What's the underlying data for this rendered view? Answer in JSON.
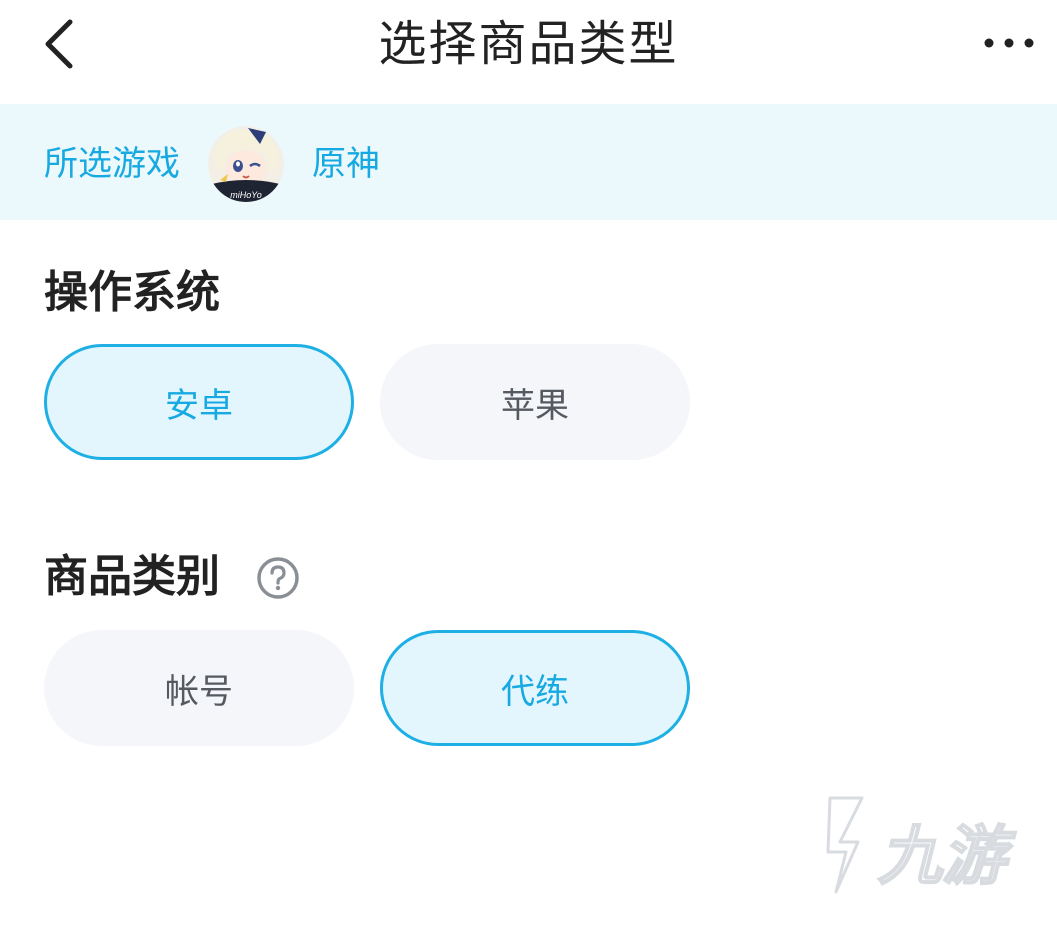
{
  "header": {
    "title": "选择商品类型",
    "back_icon": "chevron-left-icon",
    "more_icon": "more-horizontal-icon"
  },
  "game": {
    "label": "所选游戏",
    "name": "原神",
    "avatar_text": "miHoYo"
  },
  "os_section": {
    "title": "操作系统",
    "options": [
      {
        "label": "安卓",
        "selected": true
      },
      {
        "label": "苹果",
        "selected": false
      }
    ]
  },
  "category_section": {
    "title": "商品类别",
    "help_icon": "question-circle-icon",
    "options": [
      {
        "label": "帐号",
        "selected": false
      },
      {
        "label": "代练",
        "selected": true
      }
    ]
  },
  "watermark": {
    "text": "九游"
  },
  "colors": {
    "accent": "#17a9e1",
    "accent_border": "#1eb0e4",
    "selected_bg": "#e3f6fd",
    "unselected_bg": "#f4f6f9",
    "game_bar_bg": "#ebf8fc",
    "title_text": "#222222"
  }
}
